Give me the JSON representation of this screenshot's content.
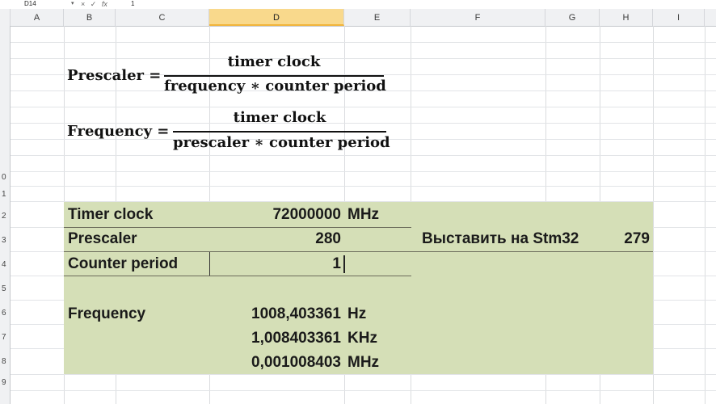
{
  "formula_bar": {
    "name_box": "D14",
    "cancel_icon": "×",
    "enter_icon": "✓",
    "fx_label": "fx",
    "value": "1"
  },
  "columns": [
    "A",
    "B",
    "C",
    "D",
    "E",
    "F",
    "G",
    "H",
    "I"
  ],
  "selected_column": "D",
  "row_labels": [
    "0",
    "1",
    "2",
    "3",
    "4",
    "5",
    "6",
    "7",
    "8",
    "9"
  ],
  "formulas": {
    "prescaler": {
      "label": "Prescaler =",
      "numerator": "timer clock",
      "denominator": "frequency ∗ counter period"
    },
    "frequency": {
      "label": "Frequency =",
      "numerator": "timer clock",
      "denominator": "prescaler ∗ counter period"
    }
  },
  "table": {
    "timer_clock": {
      "label": "Timer clock",
      "value": "72000000",
      "unit": "MHz"
    },
    "prescaler": {
      "label": "Prescaler",
      "value": "280",
      "side_label": "Выставить на Stm32",
      "side_value": "279"
    },
    "counter_period": {
      "label": "Counter period",
      "value": "1"
    },
    "frequency": {
      "label": "Frequency",
      "values": [
        {
          "value": "1008,403361",
          "unit": "Hz"
        },
        {
          "value": "1,008403361",
          "unit": "KHz"
        },
        {
          "value": "0,001008403",
          "unit": "MHz"
        }
      ]
    }
  },
  "colors": {
    "highlight_fill": "#d5dfb7",
    "selected_header": "#f9d98c"
  }
}
